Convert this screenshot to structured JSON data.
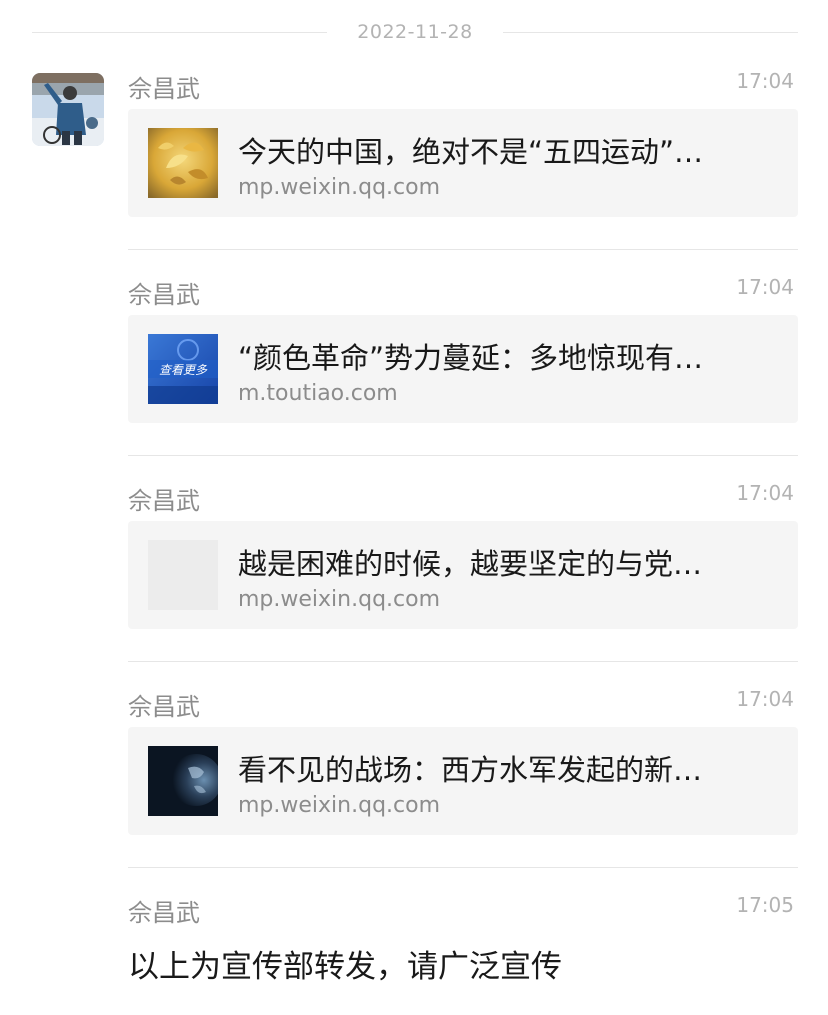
{
  "date_divider": "2022-11-28",
  "messages": [
    {
      "sender": "佘昌武",
      "time": "17:04",
      "title": "今天的中国，绝对不是“五四运动”…",
      "source": "mp.weixin.qq.com",
      "thumb_icon": "golden-leaves-thumbnail"
    },
    {
      "sender": "佘昌武",
      "time": "17:04",
      "title": "“颜色革命”势力蔓延：多地惊现有…",
      "source": "m.toutiao.com",
      "thumb_icon": "view-more-thumbnail",
      "thumb_text": "查看更多"
    },
    {
      "sender": "佘昌武",
      "time": "17:04",
      "title": "越是困难的时候，越要坚定的与党…",
      "source": "mp.weixin.qq.com",
      "thumb_icon": "blank-thumbnail"
    },
    {
      "sender": "佘昌武",
      "time": "17:04",
      "title": "看不见的战场：西方水军发起的新…",
      "source": "mp.weixin.qq.com",
      "thumb_icon": "globe-thumbnail"
    },
    {
      "sender": "佘昌武",
      "time": "17:05",
      "text": "以上为宣传部转发，请广泛宣传"
    }
  ]
}
